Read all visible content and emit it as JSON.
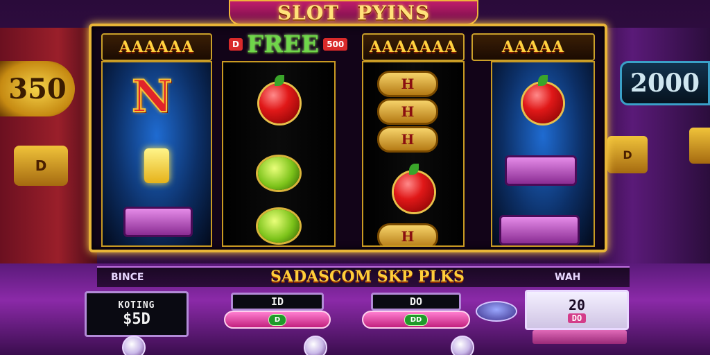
{
  "title": {
    "word1": "SLOT",
    "word2": "PYINS"
  },
  "marquees": {
    "reel1": "AAAAAA",
    "free_pill_left": "D",
    "free_text": "FREE",
    "free_pill_right": "500",
    "reel3": "AAAAAAA",
    "reel4": "AAAAA"
  },
  "background": {
    "left_sign": "350",
    "left_chest": "D",
    "right_sign": "2000",
    "right_chest": "D"
  },
  "reels": {
    "reel1_letter": "N",
    "reel3_bar_symbol": "H"
  },
  "console": {
    "left_label": "BINCE",
    "headline": "SADASCOM SKP PLKS",
    "right_label": "WAH"
  },
  "panels": {
    "winnings_label": "KOTING",
    "winnings_value": "$5D",
    "bet1_value": "ID",
    "bet2_value": "DO",
    "right_value": "20",
    "right_sub": "DO",
    "btn_left_label": "D",
    "btn_right_label": "DD"
  },
  "colors": {
    "frame_gold": "#e8b437",
    "title_gold": "#ffe27a",
    "console_purple": "#8b2aa8",
    "button_pink": "#ff7fd0"
  }
}
